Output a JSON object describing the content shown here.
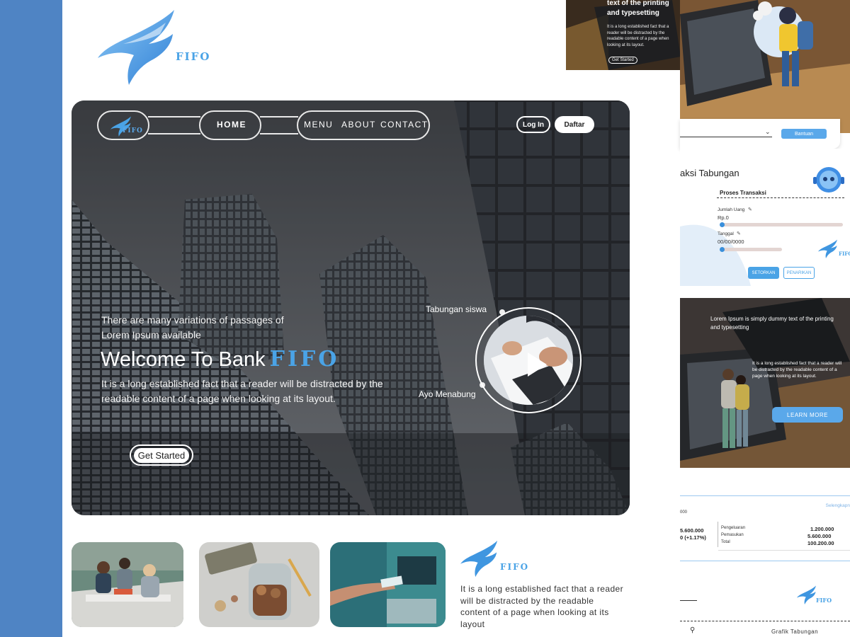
{
  "brand": {
    "name": "FIFO",
    "color": "#4aa3e6"
  },
  "nav": {
    "items": [
      "HOME",
      "MENU",
      "ABOUT",
      "CONTACT"
    ],
    "active": "HOME",
    "login_label": "Log In",
    "register_label": "Daftar"
  },
  "hero": {
    "subtitle": "There are many variations of passages of Lorem Ipsum available",
    "title_prefix": "Welcome To Bank",
    "title_brand": "FIFO",
    "body": "It is a long established fact that a reader will be distracted by the readable content of a page when looking at its layout.",
    "cta_label": "Get Started",
    "video_tag_1": "Tabungan siswa",
    "video_tag_2": "Ayo Menabung",
    "video_icon": "play-icon"
  },
  "bottom": {
    "brand_name": "FIFO",
    "text": "It is a long established fact that a reader will be distracted by the readable content of a page when looking at its layout"
  },
  "side_panel_top": {
    "title": "text of the printing and typesetting",
    "body": "It is a long established fact that a reader will be distracted by the readable content of a page when looking at its layout.",
    "cta_label": "Get Started"
  },
  "search_panel": {
    "help_label": "Bantuan"
  },
  "transaction_panel": {
    "title": "aksi Tabungan",
    "section_title": "Proses Transaksi",
    "amount_label": "Jumlah Uang",
    "amount_value": "Rp.0",
    "date_label": "Tanggal",
    "date_value": "00/00/0000",
    "deposit_label": "SETORKAN",
    "withdraw_label": "PENARIKAN",
    "brand_name": "FIFO"
  },
  "promo_panel": {
    "title": "Lorem Ipsum is simply dummy text of the printing and typesetting",
    "body": "It is a long established fact that a reader will be distracted by the readable content of a page when looking at its layout.",
    "cta_label": "LEARN MORE"
  },
  "summary_panel": {
    "more_label": "Selengkapn",
    "top_value": "000",
    "left_value_1": "5.600.000",
    "left_value_2": "0 (+1.17%)",
    "rows": [
      {
        "label": "Pengeluaran",
        "value": "1.200.000"
      },
      {
        "label": "Pemasukan",
        "value": "5.600.000"
      },
      {
        "label": "Total",
        "value": "100.200.00"
      }
    ]
  },
  "chart_panel": {
    "brand_name": "FIFO",
    "chart_label": "Grafik Tabungan"
  }
}
